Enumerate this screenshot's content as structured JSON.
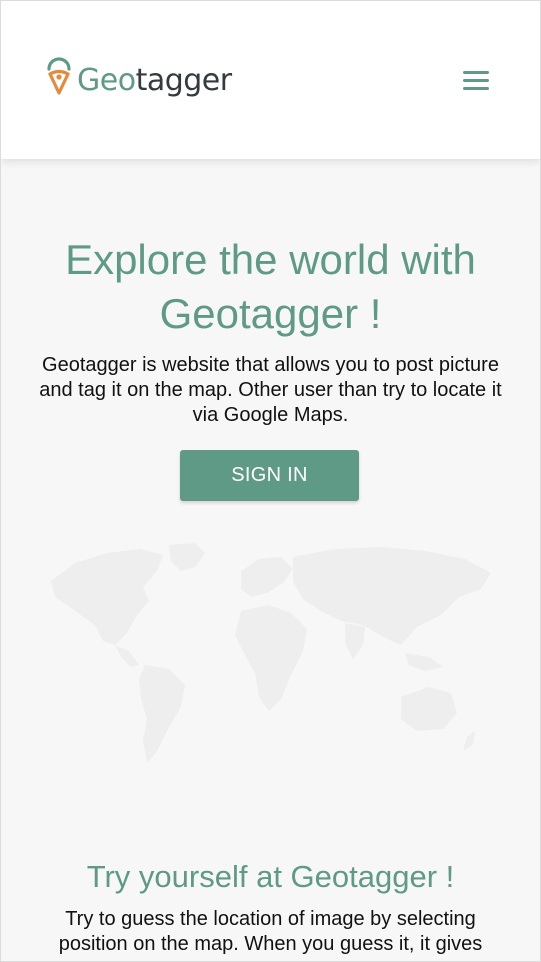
{
  "header": {
    "logo_prefix": "Geo",
    "logo_suffix": "tagger",
    "menu_icon": "hamburger-menu-icon",
    "accent_color": "#5e9a86",
    "pin_color": "#e8883a"
  },
  "hero": {
    "title": "Explore the world with Geotagger !",
    "text": "Geotagger is website that allows you to post picture and tag it on the map. Other user than try to locate it via Google Maps.",
    "signin_label": "SIGN IN",
    "map_icon": "world-map-illustration"
  },
  "section": {
    "title": "Try yourself at Geotagger !",
    "text": "Try to guess the location of image by selecting position on the map. When you guess it, it gives"
  }
}
